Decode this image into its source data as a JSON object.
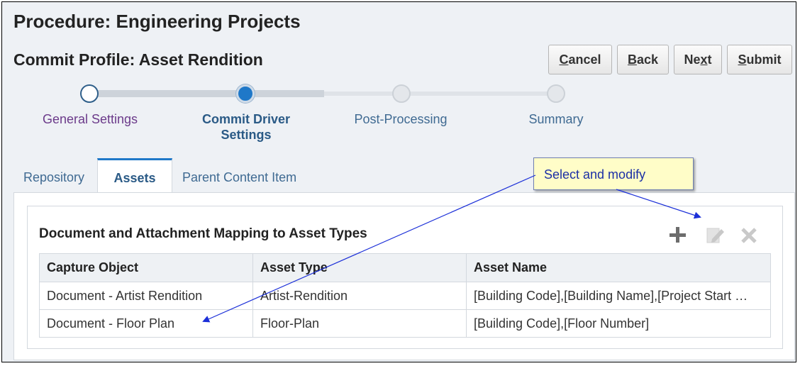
{
  "procedure_title": "Procedure: Engineering Projects",
  "profile_title": "Commit Profile: Asset Rendition",
  "buttons": {
    "cancel": {
      "underline": "C",
      "rest": "ancel"
    },
    "back": {
      "underline": "B",
      "rest": "ack"
    },
    "next": {
      "pre": "Ne",
      "underline": "x",
      "rest": "t"
    },
    "submit": {
      "underline": "S",
      "rest": "ubmit"
    }
  },
  "train": {
    "steps": [
      {
        "label": "General Settings",
        "state": "visited"
      },
      {
        "label": "Commit Driver\nSettings",
        "state": "current"
      },
      {
        "label": "Post-Processing",
        "state": "unvisited"
      },
      {
        "label": "Summary",
        "state": "unvisited"
      }
    ]
  },
  "tabs": [
    {
      "label": "Repository",
      "selected": false
    },
    {
      "label": "Assets",
      "selected": true
    },
    {
      "label": "Parent Content Item",
      "selected": false
    }
  ],
  "panel": {
    "title": "Document and Attachment Mapping to Asset Types",
    "toolbar": [
      {
        "icon": "add-icon",
        "enabled": true
      },
      {
        "icon": "edit-icon",
        "enabled": false
      },
      {
        "icon": "delete-icon",
        "enabled": false
      }
    ],
    "columns": [
      "Capture Object",
      "Asset Type",
      "Asset Name"
    ],
    "rows": [
      [
        "Document - Artist Rendition",
        "Artist-Rendition",
        "[Building Code],[Building Name],[Project Start …"
      ],
      [
        "Document - Floor Plan",
        "Floor-Plan",
        "[Building Code],[Floor Number]"
      ]
    ]
  },
  "callout": {
    "text": "Select and modify"
  },
  "colors": {
    "accent": "#1f78c8",
    "visited_step": "#6b3a8a",
    "link": "#3f6a92",
    "callout_bg": "#fffdc8",
    "callout_text": "#1b2fa6",
    "arrow": "#1b2fd8"
  }
}
